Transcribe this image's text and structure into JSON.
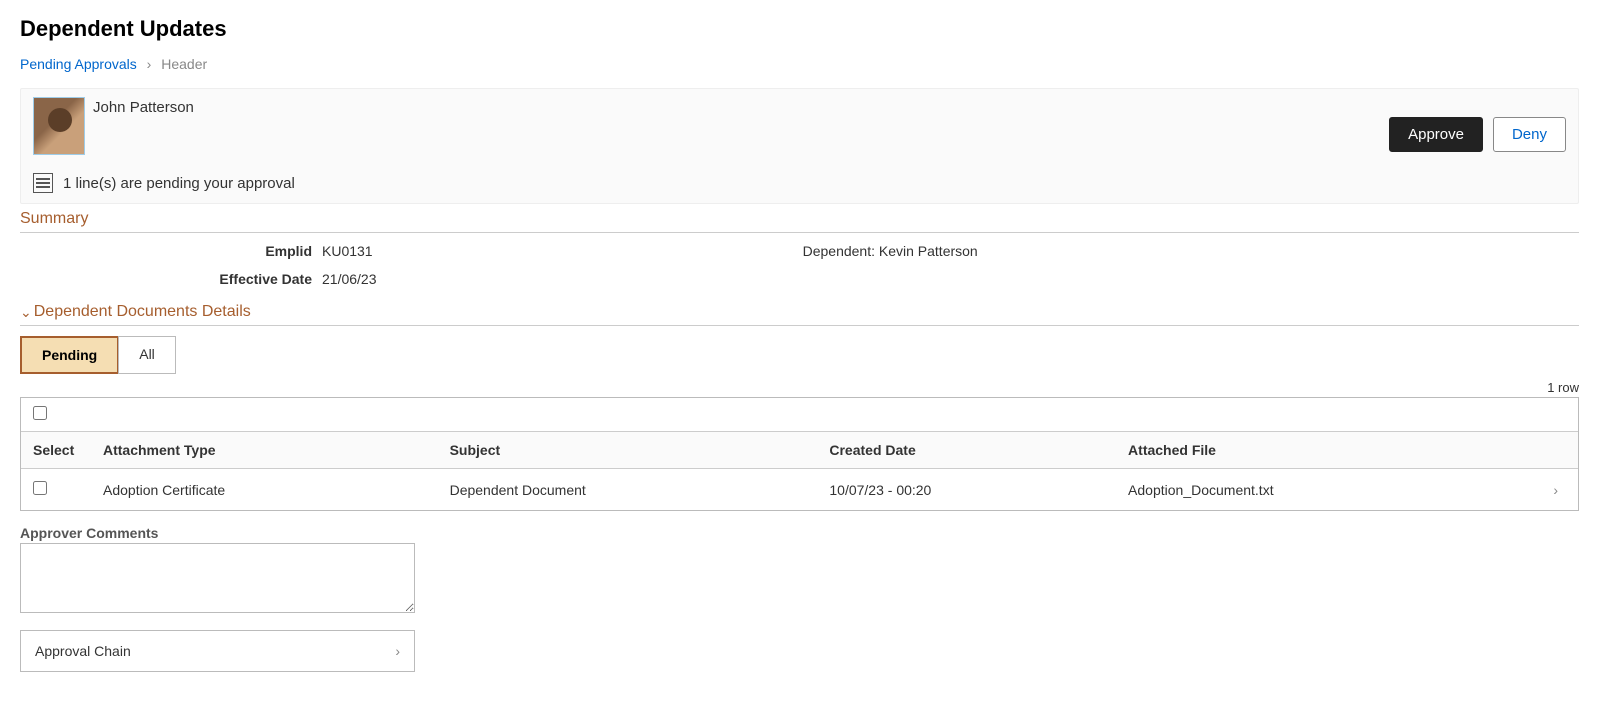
{
  "page_title": "Dependent Updates",
  "breadcrumb": {
    "parent": "Pending Approvals",
    "current": "Header"
  },
  "header": {
    "user_name": "John Patterson",
    "approve_label": "Approve",
    "deny_label": "Deny",
    "pending_text": "1 line(s) are pending your approval"
  },
  "summary": {
    "title": "Summary",
    "emplid_label": "Emplid",
    "emplid_value": "KU0131",
    "effective_date_label": "Effective Date",
    "effective_date_value": "21/06/23",
    "dependent_text": "Dependent: Kevin Patterson"
  },
  "documents": {
    "title": "Dependent Documents Details",
    "tabs": {
      "pending": "Pending",
      "all": "All"
    },
    "row_count": "1 row",
    "columns": {
      "select": "Select",
      "attachment_type": "Attachment Type",
      "subject": "Subject",
      "created_date": "Created Date",
      "attached_file": "Attached File"
    },
    "rows": [
      {
        "attachment_type": "Adoption Certificate",
        "subject": "Dependent Document",
        "created_date": "10/07/23 - 00:20",
        "attached_file": "Adoption_Document.txt"
      }
    ]
  },
  "comments": {
    "label": "Approver Comments",
    "value": ""
  },
  "approval_chain": {
    "label": "Approval Chain"
  }
}
